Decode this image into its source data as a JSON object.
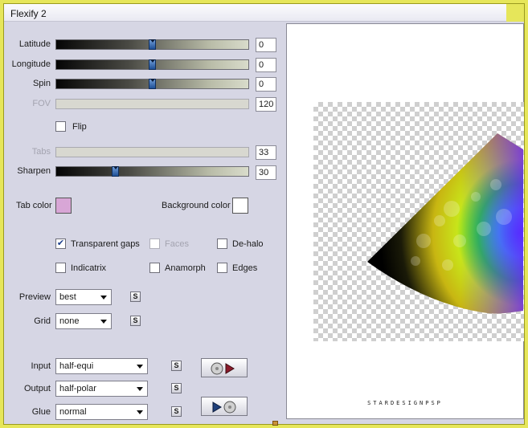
{
  "window": {
    "title": "Flexify 2"
  },
  "sliders": [
    {
      "id": "latitude",
      "label": "Latitude",
      "value": "0",
      "fraction": 0.5,
      "enabled": true
    },
    {
      "id": "longitude",
      "label": "Longitude",
      "value": "0",
      "fraction": 0.5,
      "enabled": true
    },
    {
      "id": "spin",
      "label": "Spin",
      "value": "0",
      "fraction": 0.5,
      "enabled": true
    },
    {
      "id": "fov",
      "label": "FOV",
      "value": "120",
      "fraction": null,
      "enabled": false
    },
    {
      "id": "tabs",
      "label": "Tabs",
      "value": "33",
      "fraction": null,
      "enabled": false
    },
    {
      "id": "sharpen",
      "label": "Sharpen",
      "value": "30",
      "fraction": 0.3,
      "enabled": true
    }
  ],
  "flip": {
    "label": "Flip",
    "checked": false
  },
  "tab_color": {
    "label": "Tab color",
    "color": "#d8a6d6"
  },
  "background_color": {
    "label": "Background color",
    "color": "#ffffff"
  },
  "options": {
    "transparent_gaps": {
      "label": "Transparent gaps",
      "checked": true,
      "enabled": true
    },
    "faces": {
      "label": "Faces",
      "checked": false,
      "enabled": false
    },
    "de_halo": {
      "label": "De-halo",
      "checked": false,
      "enabled": true
    },
    "indicatrix": {
      "label": "Indicatrix",
      "checked": false,
      "enabled": true
    },
    "anamorph": {
      "label": "Anamorph",
      "checked": false,
      "enabled": true
    },
    "edges": {
      "label": "Edges",
      "checked": false,
      "enabled": true
    }
  },
  "preview": {
    "label": "Preview",
    "value": "best"
  },
  "grid": {
    "label": "Grid",
    "value": "none"
  },
  "input": {
    "label": "Input",
    "value": "half-equi"
  },
  "output": {
    "label": "Output",
    "value": "half-polar"
  },
  "glue": {
    "label": "Glue",
    "value": "normal"
  },
  "s_button_label": "S",
  "watermark": "STARDESIGNPSP",
  "colors": {
    "accent": "#e6e65a",
    "panel": "#d6d6e4",
    "thumb": "#2a5aa0"
  }
}
